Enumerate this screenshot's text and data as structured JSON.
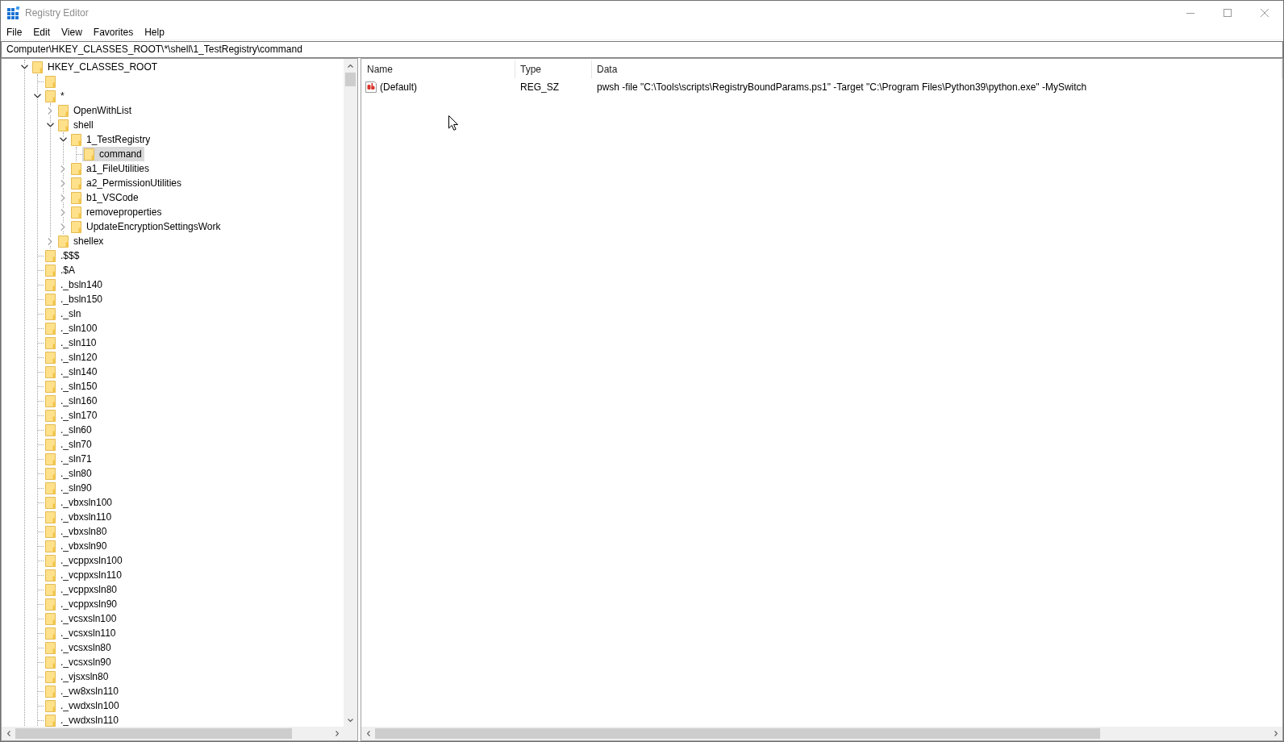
{
  "window": {
    "title": "Registry Editor"
  },
  "menu": [
    "File",
    "Edit",
    "View",
    "Favorites",
    "Help"
  ],
  "address_bar": {
    "value": "Computer\\HKEY_CLASSES_ROOT\\*\\shell\\1_TestRegistry\\command"
  },
  "tree": [
    {
      "name": "HKEY_CLASSES_ROOT",
      "expanded": true,
      "selected": false,
      "children": [
        {
          "selected": false
        },
        {
          "name": "*",
          "expanded": true,
          "selected": false,
          "children": [
            {
              "name": "OpenWithList",
              "expanded": false,
              "selected": false
            },
            {
              "name": "shell",
              "expanded": true,
              "selected": false,
              "children": [
                {
                  "name": "1_TestRegistry",
                  "expanded": true,
                  "selected": false,
                  "children": [
                    {
                      "name": "command",
                      "selected": true
                    }
                  ]
                },
                {
                  "name": "a1_FileUtilities",
                  "expanded": false,
                  "selected": false
                },
                {
                  "name": "a2_PermissionUtilities",
                  "expanded": false,
                  "selected": false
                },
                {
                  "name": "b1_VSCode",
                  "expanded": false,
                  "selected": false
                },
                {
                  "name": "removeproperties",
                  "expanded": false,
                  "selected": false
                },
                {
                  "name": "UpdateEncryptionSettingsWork",
                  "expanded": false,
                  "selected": false
                }
              ]
            },
            {
              "name": "shellex",
              "expanded": false,
              "selected": false
            }
          ]
        },
        {
          "name": ".$$$",
          "selected": false
        },
        {
          "name": ".$A",
          "selected": false
        },
        {
          "name": "._bsln140",
          "selected": false
        },
        {
          "name": "._bsln150",
          "selected": false
        },
        {
          "name": "._sln",
          "selected": false
        },
        {
          "name": "._sln100",
          "selected": false
        },
        {
          "name": "._sln110",
          "selected": false
        },
        {
          "name": "._sln120",
          "selected": false
        },
        {
          "name": "._sln140",
          "selected": false
        },
        {
          "name": "._sln150",
          "selected": false
        },
        {
          "name": "._sln160",
          "selected": false
        },
        {
          "name": "._sln170",
          "selected": false
        },
        {
          "name": "._sln60",
          "selected": false
        },
        {
          "name": "._sln70",
          "selected": false
        },
        {
          "name": "._sln71",
          "selected": false
        },
        {
          "name": "._sln80",
          "selected": false
        },
        {
          "name": "._sln90",
          "selected": false
        },
        {
          "name": "._vbxsln100",
          "selected": false
        },
        {
          "name": "._vbxsln110",
          "selected": false
        },
        {
          "name": "._vbxsln80",
          "selected": false
        },
        {
          "name": "._vbxsln90",
          "selected": false
        },
        {
          "name": "._vcppxsln100",
          "selected": false
        },
        {
          "name": "._vcppxsln110",
          "selected": false
        },
        {
          "name": "._vcppxsln80",
          "selected": false
        },
        {
          "name": "._vcppxsln90",
          "selected": false
        },
        {
          "name": "._vcsxsln100",
          "selected": false
        },
        {
          "name": "._vcsxsln110",
          "selected": false
        },
        {
          "name": "._vcsxsln80",
          "selected": false
        },
        {
          "name": "._vcsxsln90",
          "selected": false
        },
        {
          "name": "._vjsxsln80",
          "selected": false
        },
        {
          "name": "._vw8xsln110",
          "selected": false
        },
        {
          "name": "._vwdxsln100",
          "selected": false
        },
        {
          "name": "._vwdxsln110",
          "selected": false
        }
      ]
    }
  ],
  "values_list": {
    "columns": [
      "Name",
      "Type",
      "Data"
    ],
    "rows": [
      {
        "name": "(Default)",
        "type": "REG_SZ",
        "data": "pwsh -file \"C:\\Tools\\scripts\\RegistryBoundParams.ps1\" -Target \"C:\\Program Files\\Python39\\python.exe\" -MySwitch"
      }
    ]
  }
}
